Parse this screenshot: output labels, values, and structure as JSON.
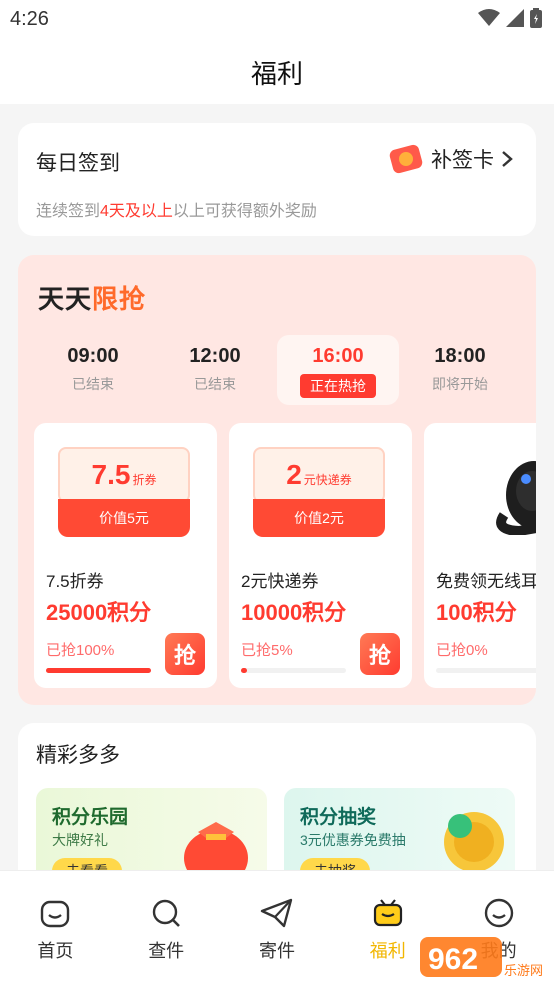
{
  "status_bar": {
    "time": "4:26"
  },
  "header": {
    "title": "福利"
  },
  "checkin": {
    "title": "每日签到",
    "makeup_label": "补签卡",
    "desc_prefix": "连续签到",
    "desc_highlight": "4天及以上",
    "desc_suffix": "以上可获得额外奖励"
  },
  "flash_sale": {
    "title_a": "天天",
    "title_b": "限抢",
    "slots": [
      {
        "time": "09:00",
        "status": "已结束"
      },
      {
        "time": "12:00",
        "status": "已结束"
      },
      {
        "time": "16:00",
        "status": "正在热抢"
      },
      {
        "time": "18:00",
        "status": "即将开始"
      }
    ],
    "deals": [
      {
        "coupon_big": "7.5",
        "coupon_small": "折券",
        "coupon_value": "价值5元",
        "name": "7.5折券",
        "points": "25000积分",
        "progress_label": "已抢100%",
        "progress": 1.0,
        "grab": "抢"
      },
      {
        "coupon_big": "2",
        "coupon_small": "元快递券",
        "coupon_value": "价值2元",
        "name": "2元快递券",
        "points": "10000积分",
        "progress_label": "已抢5%",
        "progress": 0.05,
        "grab": "抢"
      },
      {
        "name": "免费领无线耳",
        "points": "100积分",
        "progress_label": "已抢0%",
        "progress": 0.0
      }
    ]
  },
  "more": {
    "title": "精彩多多",
    "promos": [
      {
        "title": "积分乐园",
        "subtitle": "大牌好礼",
        "button": "去看看"
      },
      {
        "title": "积分抽奖",
        "subtitle": "3元优惠券免费抽",
        "button": "去抽奖"
      }
    ]
  },
  "tabbar": {
    "tabs": [
      {
        "label": "首页",
        "icon": "smile-face-icon"
      },
      {
        "label": "查件",
        "icon": "search-icon"
      },
      {
        "label": "寄件",
        "icon": "paper-plane-icon"
      },
      {
        "label": "福利",
        "icon": "gift-icon"
      },
      {
        "label": "我的",
        "icon": "smile-icon"
      }
    ],
    "active_index": 3
  },
  "watermark": {
    "text": "962",
    "subtext": "乐游网"
  },
  "colors": {
    "accent": "#ff3b30",
    "active_tab": "#f2b600",
    "flash_bg": "#ffe7e3"
  }
}
